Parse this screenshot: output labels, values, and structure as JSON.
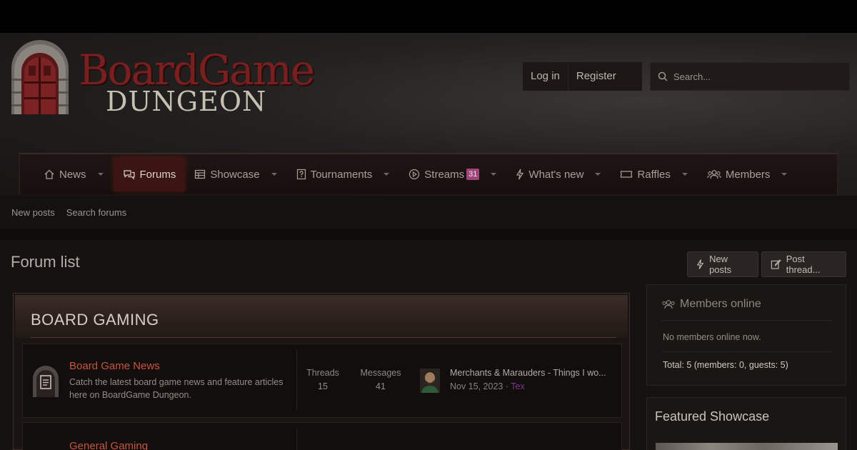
{
  "header": {
    "logo": {
      "word1": "BoardGame",
      "word2": "DUNGEON"
    },
    "auth": {
      "login": "Log in",
      "register": "Register"
    },
    "search": {
      "placeholder": "Search..."
    }
  },
  "nav": {
    "items": [
      {
        "label": "News",
        "icon": "home-icon"
      },
      {
        "label": "Forums",
        "icon": "comments-icon",
        "active": true
      },
      {
        "label": "Showcase",
        "icon": "showcase-icon"
      },
      {
        "label": "Tournaments",
        "icon": "question-book-icon"
      },
      {
        "label": "Streams",
        "icon": "play-circle-icon",
        "badge": "31"
      },
      {
        "label": "What's new",
        "icon": "bolt-icon"
      },
      {
        "label": "Raffles",
        "icon": "ticket-icon"
      },
      {
        "label": "Members",
        "icon": "users-icon"
      }
    ]
  },
  "subnav": {
    "new_posts": "New posts",
    "search_forums": "Search forums"
  },
  "main": {
    "title": "Forum list",
    "new_posts_btn": "New posts",
    "post_thread_btn": "Post thread..."
  },
  "category": {
    "title": "BOARD GAMING",
    "forums": [
      {
        "title": "Board Game News",
        "description": "Catch the latest board game news and feature articles here on BoardGame Dungeon.",
        "threads_label": "Threads",
        "threads": "15",
        "messages_label": "Messages",
        "messages": "41",
        "latest_title": "Merchants & Marauders - Things I wo...",
        "latest_date": "Nov 15, 2023",
        "latest_separator": "·",
        "latest_user": "Tex"
      },
      {
        "title": "General Gaming"
      }
    ]
  },
  "sidebar": {
    "members_online": {
      "title": "Members online",
      "empty": "No members online now.",
      "total": "Total: 5 (members: 0, guests: 5)"
    },
    "featured": {
      "title": "Featured Showcase"
    }
  },
  "colors": {
    "accent_red": "#7a1f20",
    "forum_link": "#c8553c",
    "badge": "#a0457a",
    "user_link": "#7e3a8a"
  }
}
